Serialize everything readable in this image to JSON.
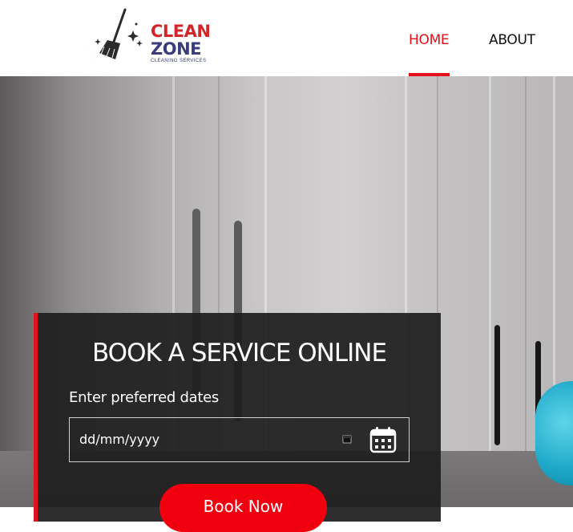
{
  "header": {
    "logo": {
      "line1": "CLEAN",
      "line2": "ZONE",
      "tagline": "CLEANING SERVICES"
    },
    "nav": [
      {
        "label": "HOME",
        "active": true
      },
      {
        "label": "ABOUT",
        "active": false
      }
    ]
  },
  "booking": {
    "title": "BOOK A SERVICE ONLINE",
    "date_label": "Enter preferred dates",
    "date_placeholder": "dd/mm/yyyy",
    "button_label": "Book Now"
  },
  "colors": {
    "accent": "#e4111a",
    "brand_red": "#d3262b",
    "brand_navy": "#3a3d7c",
    "card_bg": "#1e1e1e"
  },
  "icons": [
    "broom-logo-icon",
    "calendar-small-icon",
    "calendar-icon"
  ]
}
